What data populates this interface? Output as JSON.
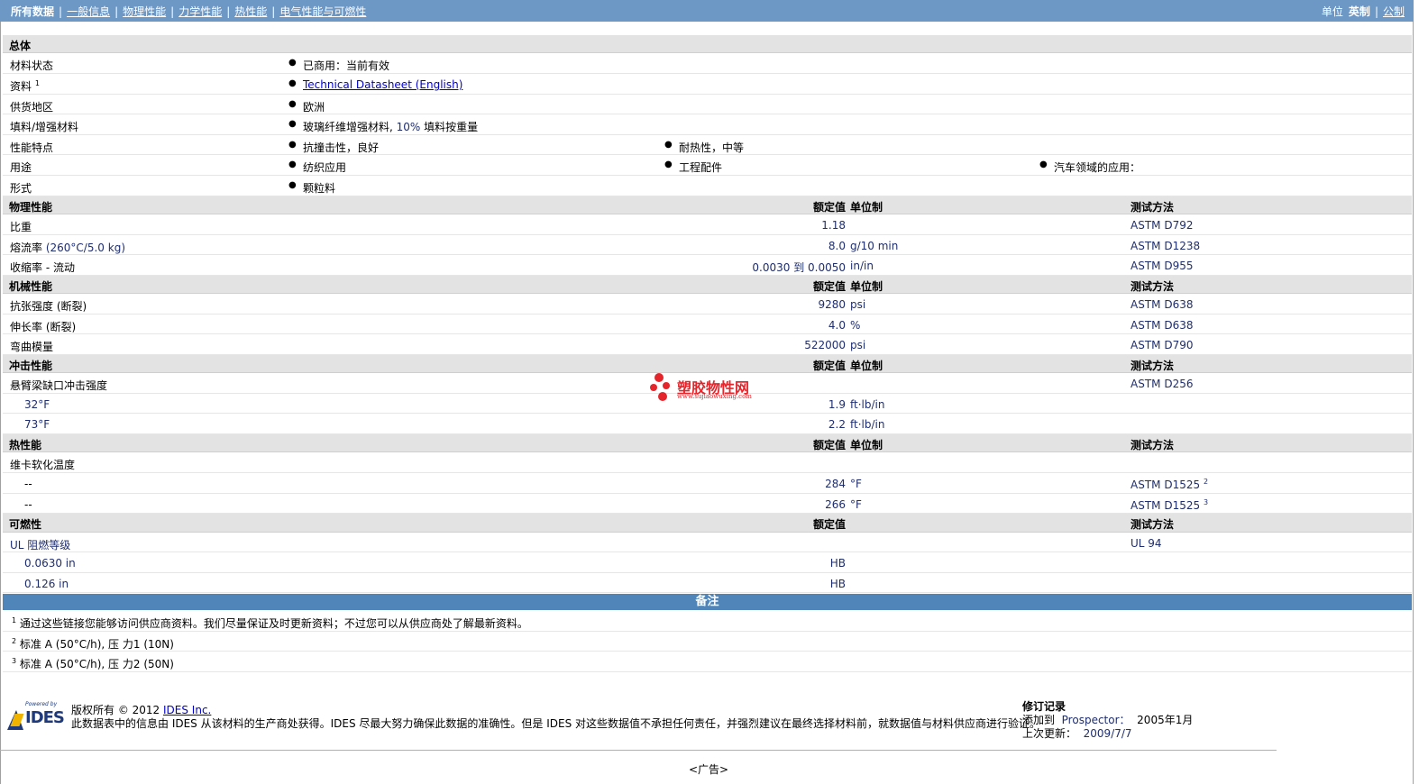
{
  "nav": {
    "tabs": [
      "所有数据",
      "一般信息",
      "物理性能",
      "力学性能",
      "热性能",
      "电气性能与可燃性"
    ],
    "unit_label": "单位",
    "unit_imperial": "英制",
    "unit_metric": "公制"
  },
  "general": {
    "title": "总体",
    "status_label": "材料状态",
    "status_value": "已商用：当前有效",
    "doc_label": "资料",
    "doc_sup": "1",
    "doc_link": "Technical Datasheet (English)",
    "region_label": "供货地区",
    "region_value": "欧洲",
    "filler_label": "填料/增强材料",
    "filler_value_a": "玻璃纤维增强材料,",
    "filler_value_b": "10%",
    "filler_value_c": "填料按重量",
    "features_label": "性能特点",
    "features": [
      "抗撞击性，良好",
      "耐热性，中等"
    ],
    "uses_label": "用途",
    "uses": [
      "纺织应用",
      "工程配件",
      "汽车领域的应用："
    ],
    "form_label": "形式",
    "form_value": "颗粒料"
  },
  "headers": {
    "nominal": "额定值",
    "unit": "单位制",
    "test": "测试方法"
  },
  "physical": {
    "title": "物理性能",
    "rows": [
      {
        "label": "比重",
        "value": "1.18",
        "unit": "",
        "test": "ASTM D792"
      },
      {
        "label": "熔流率",
        "cond": "(260°C/5.0 kg)",
        "value": "8.0",
        "unit": "g/10 min",
        "test": "ASTM D1238"
      },
      {
        "label": "收缩率",
        "cond": "- 流动",
        "value": "0.0030 到  0.0050",
        "unit": "in/in",
        "test": "ASTM D955"
      }
    ]
  },
  "mechanical": {
    "title": "机械性能",
    "rows": [
      {
        "label": "抗张强度",
        "cond": "(断裂)",
        "value": "9280",
        "unit": "psi",
        "test": "ASTM D638"
      },
      {
        "label": "伸长率",
        "cond": "(断裂)",
        "value": "4.0",
        "unit": "%",
        "test": "ASTM D638"
      },
      {
        "label": "弯曲模量",
        "value": "522000",
        "unit": "psi",
        "test": "ASTM D790"
      }
    ]
  },
  "impact": {
    "title": "冲击性能",
    "label": "悬臂梁缺口冲击强度",
    "test": "ASTM D256",
    "rows": [
      {
        "label": "32°F",
        "value": "1.9",
        "unit": "ft·lb/in"
      },
      {
        "label": "73°F",
        "value": "2.2",
        "unit": "ft·lb/in"
      }
    ]
  },
  "thermal": {
    "title": "热性能",
    "label": "维卡软化温度",
    "rows": [
      {
        "label": "--",
        "value": "284",
        "unit": "°F",
        "test": "ASTM D1525",
        "sup": "2"
      },
      {
        "label": "--",
        "value": "266",
        "unit": "°F",
        "test": "ASTM D1525",
        "sup": "3"
      }
    ]
  },
  "flammability": {
    "title": "可燃性",
    "label": "UL 阻燃等级",
    "test": "UL 94",
    "rows": [
      {
        "label": "0.0630 in",
        "value": "HB"
      },
      {
        "label": "0.126 in",
        "value": "HB"
      }
    ]
  },
  "notes": {
    "title": "备注",
    "items": [
      {
        "sup": "1",
        "text": "通过这些链接您能够访问供应商资料。我们尽量保证及时更新资料；不过您可以从供应商处了解最新资料。"
      },
      {
        "sup": "2",
        "text": "标准  A (50°C/h), 压  力1 (10N)"
      },
      {
        "sup": "3",
        "text": "标准  A (50°C/h), 压  力2 (50N)"
      }
    ]
  },
  "footer": {
    "powered_by": "Powered by",
    "logo_text": "IDES",
    "copyright_prefix": "版权所有  © 2012",
    "copyright_link": "IDES Inc.",
    "disclaimer": "此数据表中的信息由  IDES 从该材料的生产商处获得。IDES 尽最大努力确保此数据的准确性。但是  IDES 对这些数据值不承担任何责任，并强烈建议在最终选择材料前，就数据值与材料供应商进行验证。",
    "rev_title": "修订记录",
    "added_label": "添加到",
    "added_site": "Prospector：",
    "added_date": "2005年1月",
    "updated_label": "上次更新：",
    "updated_date": "2009/7/7",
    "ad": "<广告>"
  },
  "watermark": {
    "name": "塑胶物性网",
    "url": "www.sujiaowuxing.com",
    "color": "#e4252b"
  },
  "colors": {
    "nav_bg": "#6d97c4",
    "section_bg": "#e3e3e3",
    "notes_bg": "#4f85b9"
  }
}
